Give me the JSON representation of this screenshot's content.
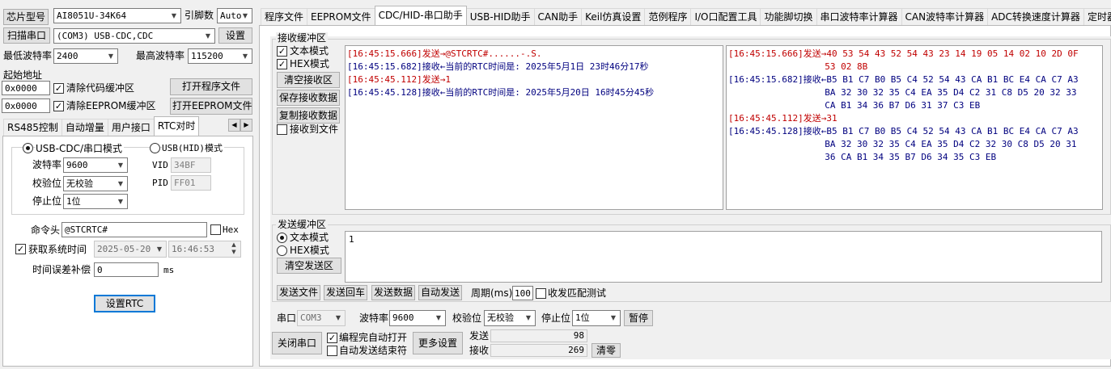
{
  "left": {
    "chip_label": "芯片型号",
    "chip_value": "AI8051U-34K64",
    "pin_label": "引脚数",
    "pin_value": "Auto",
    "scan_button": "扫描串口",
    "port_value": "(COM3) USB-CDC,CDC",
    "settings_button": "设置",
    "min_baud_label": "最低波特率",
    "min_baud_value": "2400",
    "max_baud_label": "最高波特率",
    "max_baud_value": "115200",
    "start_addr_label": "起始地址",
    "code_addr": "0x0000",
    "clear_code_label": "清除代码缓冲区",
    "open_prog_button": "打开程序文件",
    "eeprom_addr": "0x0000",
    "clear_eeprom_label": "清除EEPROM缓冲区",
    "open_eeprom_button": "打开EEPROM文件",
    "tabs": [
      "RS485控制",
      "自动增量",
      "用户接口",
      "RTC对时"
    ],
    "rtc": {
      "cdc_mode_label": "USB-CDC/串口模式",
      "hid_mode_label": "USB(HID)模式",
      "baud_label": "波特率",
      "baud_value": "9600",
      "parity_label": "校验位",
      "parity_value": "无校验",
      "stop_label": "停止位",
      "stop_value": "1位",
      "vid_label": "VID",
      "vid_value": "34BF",
      "pid_label": "PID",
      "pid_value": "FF01",
      "cmd_label": "命令头",
      "cmd_value": "@STCRTC#",
      "hex_label": "Hex",
      "get_time_label": "获取系统时间",
      "date_value": "2025-05-20",
      "time_value": "16:46:53",
      "offset_label": "时间误差补偿",
      "offset_value": "0",
      "offset_unit": "ms",
      "set_rtc_button": "设置RTC"
    }
  },
  "top_tabs": [
    "程序文件",
    "EEPROM文件",
    "CDC/HID-串口助手",
    "USB-HID助手",
    "CAN助手",
    "Keil仿真设置",
    "范例程序",
    "I/O口配置工具",
    "功能脚切换",
    "串口波特率计算器",
    "CAN波特率计算器",
    "ADC转换速度计算器",
    "定时器计"
  ],
  "recv": {
    "title": "接收缓冲区",
    "text_mode": "文本模式",
    "hex_mode": "HEX模式",
    "clear_button": "清空接收区",
    "save_button": "保存接收数据",
    "copy_button": "复制接收数据",
    "to_file_label": "接收到文件",
    "text_lines": [
      {
        "t": "[16:45:15.666]发送→@STCRTC#......-.S.",
        "c": "#c00000"
      },
      {
        "t": "[16:45:15.682]接收←当前的RTC时间是: 2025年5月1日 23时46分17秒",
        "c": "#00007f"
      },
      {
        "t": "[16:45:45.112]发送→1",
        "c": "#c00000"
      },
      {
        "t": "[16:45:45.128]接收←当前的RTC时间是: 2025年5月20日 16时45分45秒",
        "c": "#00007f"
      }
    ],
    "hex_lines": [
      {
        "t": "[16:45:15.666]发送→40 53 54 43 52 54 43 23 14 19 05 14 02 10 2D 0F",
        "c": "#c00000"
      },
      {
        "t": "                  53 02 8B",
        "c": "#c00000"
      },
      {
        "t": "[16:45:15.682]接收←B5 B1 C7 B0 B5 C4 52 54 43 CA B1 BC E4 CA C7 A3",
        "c": "#00007f"
      },
      {
        "t": "                  BA 32 30 32 35 C4 EA 35 D4 C2 31 C8 D5 20 32 33",
        "c": "#00007f"
      },
      {
        "t": "                  CA B1 34 36 B7 D6 31 37 C3 EB",
        "c": "#00007f"
      },
      {
        "t": "[16:45:45.112]发送→31",
        "c": "#c00000"
      },
      {
        "t": "[16:45:45.128]接收←B5 B1 C7 B0 B5 C4 52 54 43 CA B1 BC E4 CA C7 A3",
        "c": "#00007f"
      },
      {
        "t": "                  BA 32 30 32 35 C4 EA 35 D4 C2 32 30 C8 D5 20 31",
        "c": "#00007f"
      },
      {
        "t": "                  36 CA B1 34 35 B7 D6 34 35 C3 EB",
        "c": "#00007f"
      }
    ]
  },
  "send": {
    "title": "发送缓冲区",
    "text_mode": "文本模式",
    "hex_mode": "HEX模式",
    "clear_button": "清空发送区",
    "content": "1",
    "send_file_button": "发送文件",
    "send_return_button": "发送回车",
    "send_data_button": "发送数据",
    "auto_send_button": "自动发送",
    "period_label": "周期(ms)",
    "period_value": "100",
    "match_label": "收发匹配测试"
  },
  "bottom": {
    "port_label": "串口",
    "port_value": "COM3",
    "baud_label": "波特率",
    "baud_value": "9600",
    "parity_label": "校验位",
    "parity_value": "无校验",
    "stop_label": "停止位",
    "stop_value": "1位",
    "pause_button": "暂停",
    "close_button": "关闭串口",
    "auto_open_label": "编程完自动打开",
    "auto_end_label": "自动发送结束符",
    "more_button": "更多设置",
    "sent_label": "发送",
    "sent_count": "98",
    "recv_label": "接收",
    "recv_count": "269",
    "reset_button": "清零"
  }
}
